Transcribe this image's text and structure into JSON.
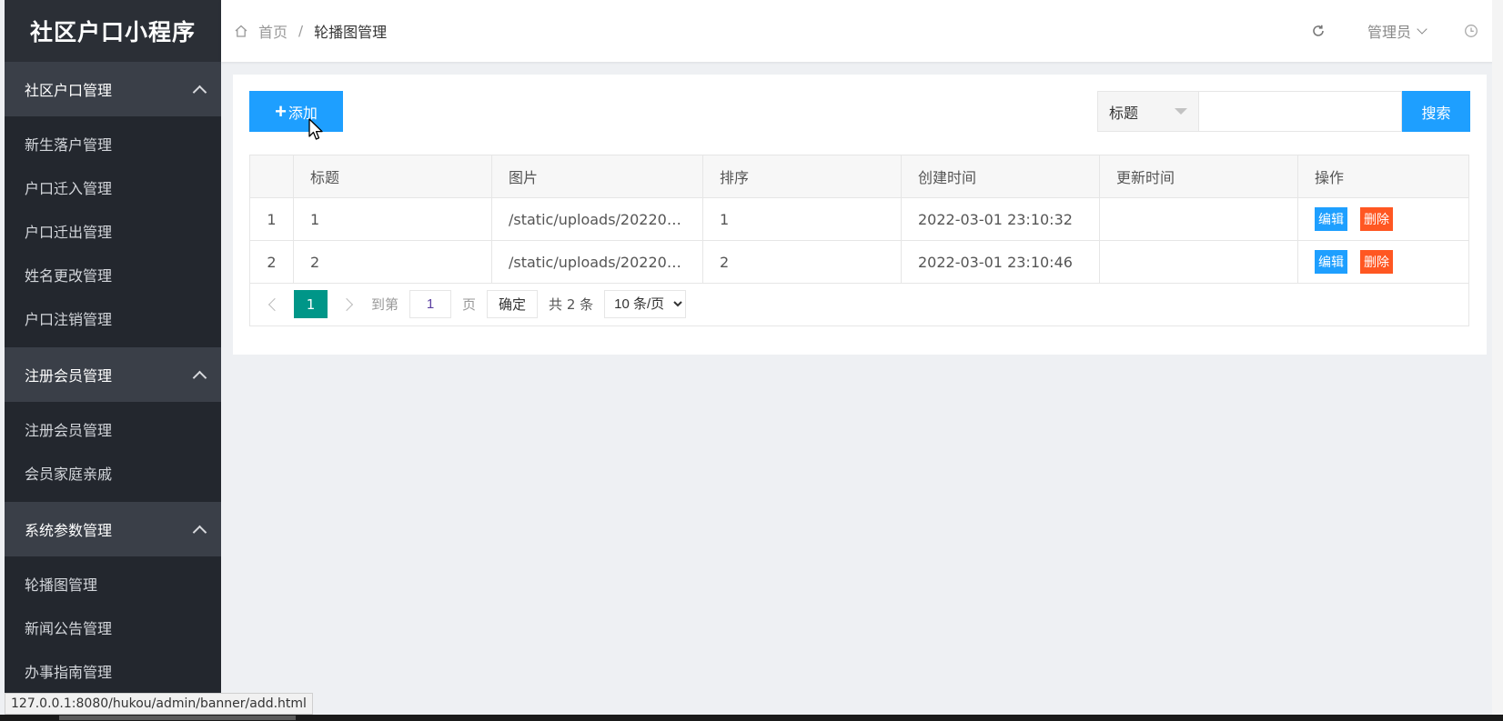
{
  "app": {
    "title": "社区户口小程序"
  },
  "sidebar": {
    "groups": [
      {
        "label": "社区户口管理",
        "items": [
          "新生落户管理",
          "户口迁入管理",
          "户口迁出管理",
          "姓名更改管理",
          "户口注销管理"
        ]
      },
      {
        "label": "注册会员管理",
        "items": [
          "注册会员管理",
          "会员家庭亲戚"
        ]
      },
      {
        "label": "系统参数管理",
        "items": [
          "轮播图管理",
          "新闻公告管理",
          "办事指南管理"
        ]
      }
    ]
  },
  "header": {
    "breadcrumb_home": "首页",
    "breadcrumb_sep": "/",
    "breadcrumb_current": "轮播图管理",
    "user": "管理员",
    "icons": [
      "home-icon",
      "refresh-icon",
      "chevron-down-icon",
      "clock-icon"
    ]
  },
  "toolbar": {
    "add_label": "添加",
    "add_icon": "+",
    "search_field": "标题",
    "search_placeholder": "",
    "search_button": "搜索"
  },
  "table": {
    "columns": [
      "",
      "标题",
      "图片",
      "排序",
      "创建时间",
      "更新时间",
      "操作"
    ],
    "rows": [
      {
        "index": "1",
        "title": "1",
        "image": "/static/uploads/202203...",
        "sort": "1",
        "created": "2022-03-01 23:10:32",
        "updated": "",
        "edit": "编辑",
        "delete": "删除"
      },
      {
        "index": "2",
        "title": "2",
        "image": "/static/uploads/202203...",
        "sort": "2",
        "created": "2022-03-01 23:10:46",
        "updated": "",
        "edit": "编辑",
        "delete": "删除"
      }
    ]
  },
  "pagination": {
    "current": "1",
    "goto_label": "到第",
    "goto_value": "1",
    "page_label": "页",
    "confirm": "确定",
    "total": "共 2 条",
    "page_size": "10 条/页"
  },
  "statusbar": {
    "url": "127.0.0.1:8080/hukou/admin/banner/add.html"
  },
  "colors": {
    "primary": "#1e9fff",
    "danger": "#ff5722",
    "pager_active": "#009688",
    "sidebar": "#2b2f36"
  }
}
